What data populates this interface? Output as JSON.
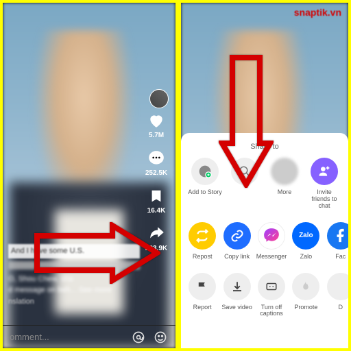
{
  "watermark": "snaptik.vn",
  "left": {
    "likes": "5.7M",
    "comments": "252.5K",
    "saves": "16.4K",
    "shares": "223.9K",
    "caption_l1": "And I have some U.S.",
    "caption_l3": "O, Shou Chew, sha",
    "caption_l4": "d message on beh...  See more",
    "translate": "nslation",
    "comment_ph": "omment..."
  },
  "right": {
    "share_to": "Share to",
    "row1": [
      {
        "label": "Add to Story"
      },
      {
        "label": ""
      },
      {
        "label": "More"
      },
      {
        "label": "Invite friends to chat"
      }
    ],
    "row2": [
      {
        "label": "Repost"
      },
      {
        "label": "Copy link"
      },
      {
        "label": "Messenger"
      },
      {
        "label": "Zalo"
      },
      {
        "label": "Fac"
      }
    ],
    "row3": [
      {
        "label": "Report"
      },
      {
        "label": "Save video"
      },
      {
        "label": "Turn off captions"
      },
      {
        "label": "Promote"
      },
      {
        "label": "D"
      }
    ]
  }
}
